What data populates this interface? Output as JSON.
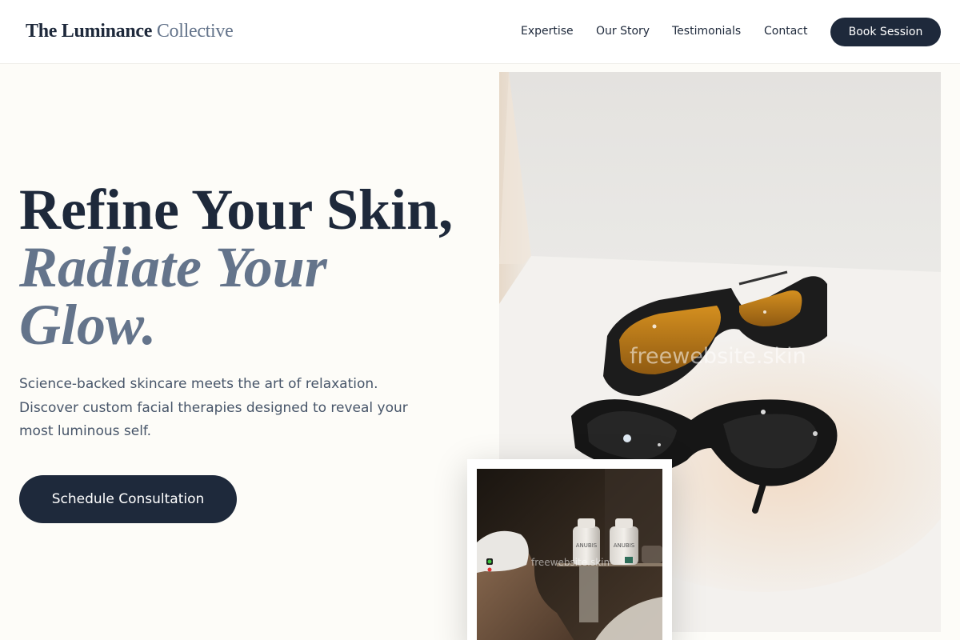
{
  "header": {
    "logo_strong": "The Luminance",
    "logo_light": "Collective",
    "nav": [
      "Expertise",
      "Our Story",
      "Testimonials",
      "Contact"
    ],
    "cta_label": "Book Session"
  },
  "hero": {
    "headline_line1": "Refine Your Skin,",
    "headline_line2": "Radiate Your Glow.",
    "subtext": "Science-backed skincare meets the art of relaxation. Discover custom facial therapies designed to reveal your most luminous self.",
    "cta_label": "Schedule Consultation"
  },
  "images": {
    "main_watermark": "freewebsite.skin",
    "inset_watermark": "freewebsite.skin",
    "inset_bottle_label": "ANUBIS"
  },
  "colors": {
    "primary": "#1e293b",
    "muted": "#64748b",
    "body_text": "#475569",
    "background": "#fdfcf8"
  }
}
